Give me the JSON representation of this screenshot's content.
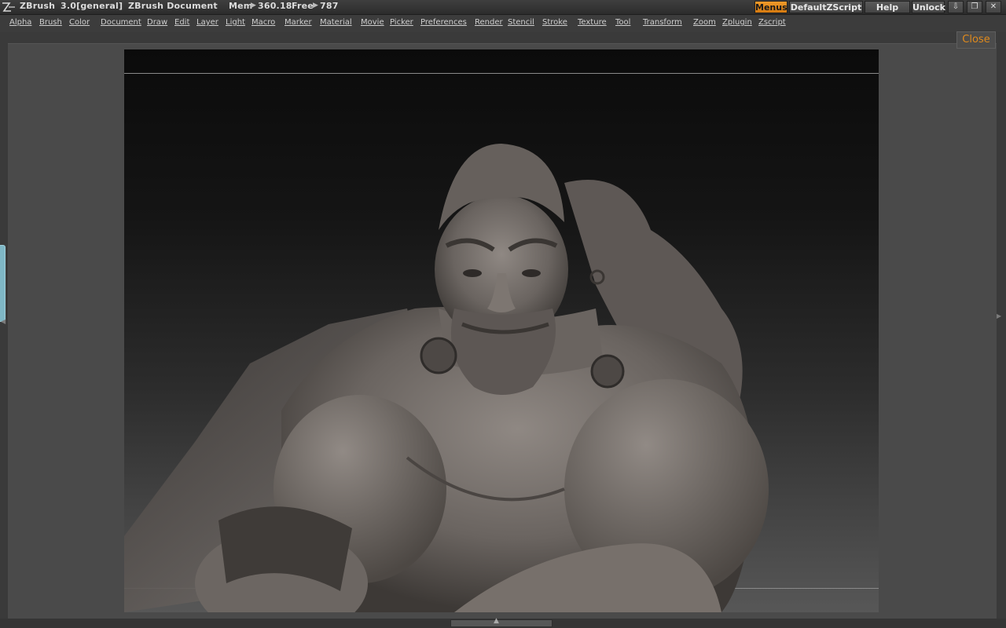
{
  "titlebar": {
    "app_name": "ZBrush",
    "version": "3.0[general]",
    "document": "ZBrush Document",
    "mem_label": "Mem",
    "mem_value": "360.18",
    "free_label": "Free",
    "free_value": "787",
    "buttons": {
      "menus": "Menus",
      "default_zscript": "DefaultZScript",
      "help": "Help",
      "unlock": "Unlock"
    },
    "window_controls": {
      "minimize_icon": "minimize-icon",
      "restore_icon": "restore-icon",
      "close_icon": "close-icon"
    }
  },
  "menubar": {
    "items": [
      "Alpha",
      "Brush",
      "Color",
      "Document",
      "Draw",
      "Edit",
      "Layer",
      "Light",
      "Macro",
      "Marker",
      "Material",
      "Movie",
      "Picker",
      "Preferences",
      "Render",
      "Stencil",
      "Stroke",
      "Texture",
      "Tool",
      "Transform",
      "Zoom",
      "Zplugin",
      "Zscript"
    ]
  },
  "document": {
    "close_label": "Close"
  },
  "colors": {
    "accent": "#e08a1c",
    "active_button": "#ef9a2a",
    "ui_background": "#3a3a3a",
    "side_tab": "#7fb7c5"
  }
}
